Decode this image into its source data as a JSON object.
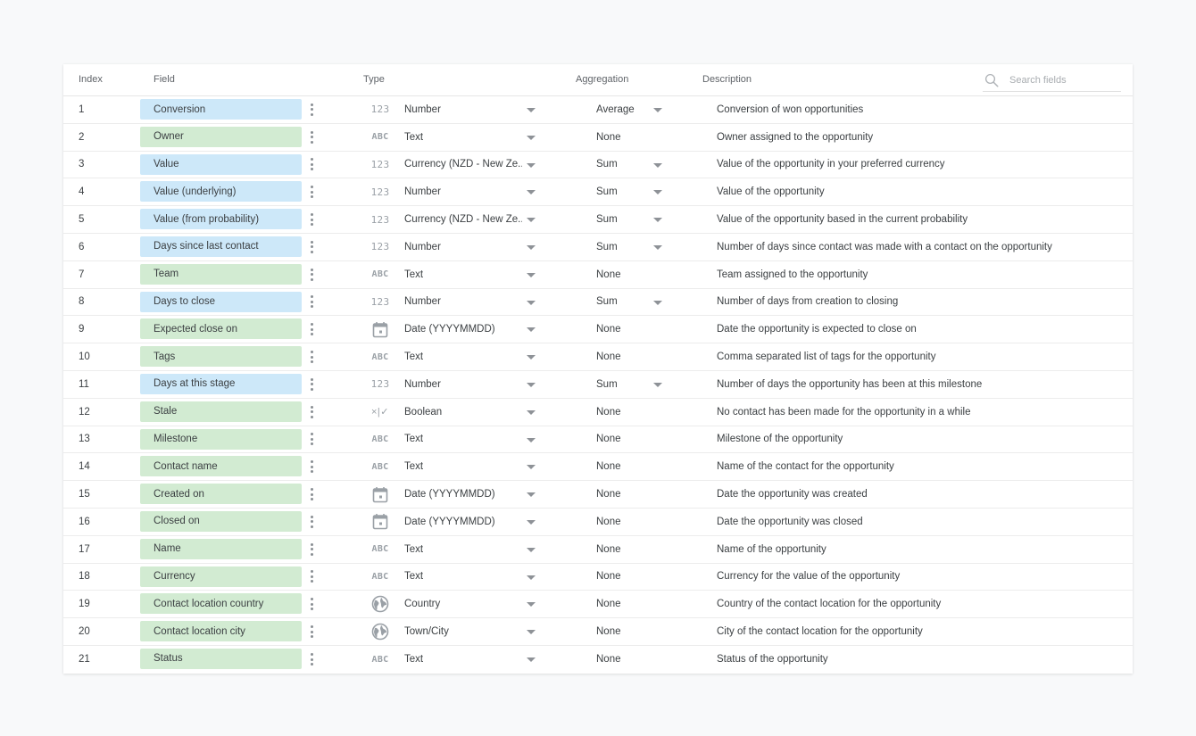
{
  "header": {
    "index": "Index",
    "field": "Field",
    "type": "Type",
    "aggregation": "Aggregation",
    "description": "Description",
    "search_placeholder": "Search fields",
    "search_value": "",
    "search_icon": "search-icon"
  },
  "colors": {
    "dimension_bg": "#cde8f9",
    "metric_bg": "#d2ebd2"
  },
  "rows": [
    {
      "index": "1",
      "field": "Conversion",
      "kind": "dim",
      "type_icon": "number-icon",
      "type": "Number",
      "aggregation": "Average",
      "agg_dropdown": true,
      "description": "Conversion of won opportunities"
    },
    {
      "index": "2",
      "field": "Owner",
      "kind": "met",
      "type_icon": "text-icon",
      "type": "Text",
      "aggregation": "None",
      "agg_dropdown": false,
      "description": "Owner assigned to the opportunity"
    },
    {
      "index": "3",
      "field": "Value",
      "kind": "dim",
      "type_icon": "number-icon",
      "type": "Currency (NZD - New Ze...",
      "aggregation": "Sum",
      "agg_dropdown": true,
      "description": "Value of the opportunity in your preferred currency"
    },
    {
      "index": "4",
      "field": "Value (underlying)",
      "kind": "dim",
      "type_icon": "number-icon",
      "type": "Number",
      "aggregation": "Sum",
      "agg_dropdown": true,
      "description": "Value of the opportunity"
    },
    {
      "index": "5",
      "field": "Value (from probability)",
      "kind": "dim",
      "type_icon": "number-icon",
      "type": "Currency (NZD - New Ze...",
      "aggregation": "Sum",
      "agg_dropdown": true,
      "description": "Value of the opportunity based in the current probability"
    },
    {
      "index": "6",
      "field": "Days since last contact",
      "kind": "dim",
      "type_icon": "number-icon",
      "type": "Number",
      "aggregation": "Sum",
      "agg_dropdown": true,
      "description": "Number of days since contact was made with a contact on the opportunity"
    },
    {
      "index": "7",
      "field": "Team",
      "kind": "met",
      "type_icon": "text-icon",
      "type": "Text",
      "aggregation": "None",
      "agg_dropdown": false,
      "description": "Team assigned to the opportunity"
    },
    {
      "index": "8",
      "field": "Days to close",
      "kind": "dim",
      "type_icon": "number-icon",
      "type": "Number",
      "aggregation": "Sum",
      "agg_dropdown": true,
      "description": "Number of days from creation to closing"
    },
    {
      "index": "9",
      "field": "Expected close on",
      "kind": "met",
      "type_icon": "calendar-icon",
      "type": "Date (YYYYMMDD)",
      "aggregation": "None",
      "agg_dropdown": false,
      "description": "Date the opportunity is expected to close on"
    },
    {
      "index": "10",
      "field": "Tags",
      "kind": "met",
      "type_icon": "text-icon",
      "type": "Text",
      "aggregation": "None",
      "agg_dropdown": false,
      "description": "Comma separated list of tags for the opportunity"
    },
    {
      "index": "11",
      "field": "Days at this stage",
      "kind": "dim",
      "type_icon": "number-icon",
      "type": "Number",
      "aggregation": "Sum",
      "agg_dropdown": true,
      "description": "Number of days the opportunity has been at this milestone"
    },
    {
      "index": "12",
      "field": "Stale",
      "kind": "met",
      "type_icon": "boolean-icon",
      "type": "Boolean",
      "aggregation": "None",
      "agg_dropdown": false,
      "description": "No contact has been made for the opportunity in a while"
    },
    {
      "index": "13",
      "field": "Milestone",
      "kind": "met",
      "type_icon": "text-icon",
      "type": "Text",
      "aggregation": "None",
      "agg_dropdown": false,
      "description": "Milestone of the opportunity"
    },
    {
      "index": "14",
      "field": "Contact name",
      "kind": "met",
      "type_icon": "text-icon",
      "type": "Text",
      "aggregation": "None",
      "agg_dropdown": false,
      "description": "Name of the contact for the opportunity"
    },
    {
      "index": "15",
      "field": "Created on",
      "kind": "met",
      "type_icon": "calendar-icon",
      "type": "Date (YYYYMMDD)",
      "aggregation": "None",
      "agg_dropdown": false,
      "description": "Date the opportunity was created"
    },
    {
      "index": "16",
      "field": "Closed on",
      "kind": "met",
      "type_icon": "calendar-icon",
      "type": "Date (YYYYMMDD)",
      "aggregation": "None",
      "agg_dropdown": false,
      "description": "Date the opportunity was closed"
    },
    {
      "index": "17",
      "field": "Name",
      "kind": "met",
      "type_icon": "text-icon",
      "type": "Text",
      "aggregation": "None",
      "agg_dropdown": false,
      "description": "Name of the opportunity"
    },
    {
      "index": "18",
      "field": "Currency",
      "kind": "met",
      "type_icon": "text-icon",
      "type": "Text",
      "aggregation": "None",
      "agg_dropdown": false,
      "description": "Currency for the value of the opportunity"
    },
    {
      "index": "19",
      "field": "Contact location country",
      "kind": "met",
      "type_icon": "globe-icon",
      "type": "Country",
      "aggregation": "None",
      "agg_dropdown": false,
      "description": "Country of the contact location for the opportunity"
    },
    {
      "index": "20",
      "field": "Contact location city",
      "kind": "met",
      "type_icon": "globe-icon",
      "type": "Town/City",
      "aggregation": "None",
      "agg_dropdown": false,
      "description": "City of the contact location for the opportunity"
    },
    {
      "index": "21",
      "field": "Status",
      "kind": "met",
      "type_icon": "text-icon",
      "type": "Text",
      "aggregation": "None",
      "agg_dropdown": false,
      "description": "Status of the opportunity"
    }
  ]
}
